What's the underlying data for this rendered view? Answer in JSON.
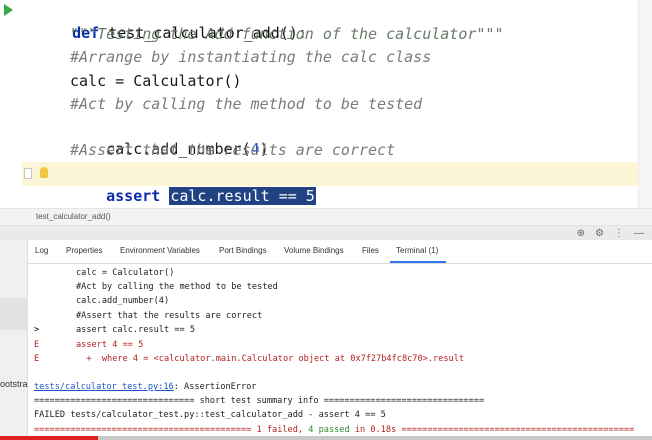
{
  "editor": {
    "lines": [
      {
        "kw": "def",
        "name": "test_calculator_add",
        "rest": "():"
      },
      {
        "text": "\"\"\"Testing the Add function of the calculator\"\"\""
      },
      {
        "text": "#Arrange by instantiating the calc class"
      },
      {
        "text": "calc = Calculator()"
      },
      {
        "text": "#Act by calling the method to be tested"
      },
      {
        "prefix": "calc.add_number(",
        "number": "4",
        "suffix": ")"
      },
      {
        "text": "#Assert that the results are correct"
      },
      {
        "kw": "assert",
        "selected": "calc.result == 5"
      }
    ]
  },
  "breadcrumb": "test_calculator_add()",
  "tabs": [
    {
      "label": "Log"
    },
    {
      "label": "Properties"
    },
    {
      "label": "Environment Variables"
    },
    {
      "label": "Port Bindings"
    },
    {
      "label": "Volume Bindings"
    },
    {
      "label": "Files"
    },
    {
      "label": "Terminal (1)",
      "active": true
    }
  ],
  "terminal": {
    "lines": [
      {
        "marker": "",
        "text": "calc = Calculator()"
      },
      {
        "marker": "",
        "text": "#Act by calling the method to be tested"
      },
      {
        "marker": "",
        "text": "calc.add_number(4)"
      },
      {
        "marker": "",
        "text": "#Assert that the results are correct"
      },
      {
        "marker": ">",
        "text": "assert calc.result == 5"
      },
      {
        "marker": "E",
        "text": "assert 4 == 5"
      },
      {
        "marker": "E",
        "text": "  +  where 4 = <calculator.main.Calculator object at 0x7f27b4fc8c70>.result"
      }
    ],
    "error_location": "tests/calculator_test.py:16",
    "error_type": ": AssertionError",
    "summary_header": "=============================== short test summary info ===============================",
    "failed_line": "FAILED tests/calculator_test.py::test_calculator_add - assert 4 == 5",
    "result_prefix": "==========================================",
    "result_failed": "1 failed,",
    "result_passed": "4 passed",
    "result_time": "in 0.18s",
    "result_suffix": "============================================="
  },
  "left_strip_label": "ootstra",
  "video_progress_fraction": 0.15,
  "colors": {
    "selection": "#214283",
    "accent": "#3574f0",
    "error": "#b22222",
    "run": "#3ea548"
  }
}
